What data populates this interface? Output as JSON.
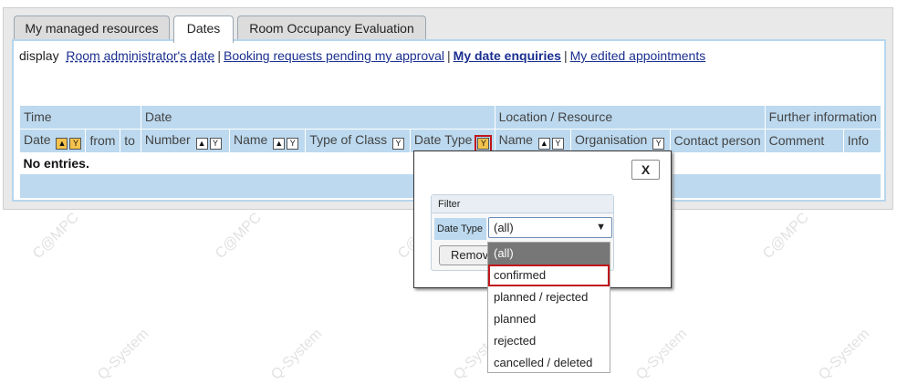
{
  "watermark": {
    "text": "Q-System",
    "alt_text": "C@MPC"
  },
  "tabs": [
    {
      "label": "My managed resources"
    },
    {
      "label": "Dates",
      "active": true
    },
    {
      "label": "Room Occupancy Evaluation"
    }
  ],
  "display": {
    "prefix": "display",
    "links": [
      {
        "label": "Room administrator's date"
      },
      {
        "label": "Booking requests pending my approval"
      },
      {
        "label": "My date enquiries",
        "active": true
      },
      {
        "label": "My edited appointments"
      }
    ],
    "separator": "|"
  },
  "table": {
    "groups": [
      "Time",
      "Date",
      "Location / Resource",
      "Further information"
    ],
    "columns": [
      "Date",
      "from",
      "to",
      "Number",
      "Name",
      "Type of Class",
      "Date Type",
      "Name",
      "Organisation",
      "Contact person",
      "Comment",
      "Info"
    ],
    "empty_text": "No entries."
  },
  "filter_popup": {
    "close_label": "X",
    "title": "Filter",
    "field_label": "Date Type",
    "selected_value": "(all)",
    "remove_label": "Remove"
  },
  "dropdown": {
    "options": [
      "(all)",
      "confirmed",
      "planned / rejected",
      "planned",
      "rejected",
      "cancelled / deleted"
    ],
    "selected": "(all)",
    "highlighted": "confirmed"
  },
  "icons": {
    "sort": "sort-asc-desc-icon",
    "filter": "filter-funnel-icon"
  },
  "colors": {
    "header_bg": "#bcd9ef",
    "link": "#1a2f8f",
    "highlight": "#c0161b"
  }
}
